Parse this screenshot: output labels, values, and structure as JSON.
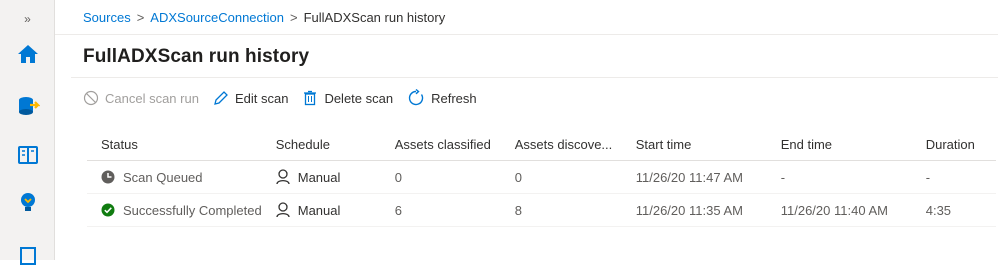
{
  "rail": {
    "expand_label": "»",
    "icons": [
      "home-icon",
      "data-source-icon",
      "catalog-icon",
      "insights-icon",
      "management-icon"
    ]
  },
  "breadcrumb": {
    "sources": "Sources",
    "connection": "ADXSourceConnection",
    "current": "FullADXScan run history",
    "separator": ">"
  },
  "page_title": "FullADXScan run history",
  "toolbar": {
    "cancel_label": "Cancel scan run",
    "edit_label": "Edit scan",
    "delete_label": "Delete scan",
    "refresh_label": "Refresh"
  },
  "table": {
    "columns": [
      "Status",
      "Schedule",
      "Assets classified",
      "Assets discove...",
      "Start time",
      "End time",
      "Duration"
    ],
    "rows": [
      {
        "status": "Scan Queued",
        "status_icon": "clock-icon",
        "schedule": "Manual",
        "assets_classified": "0",
        "assets_discovered": "0",
        "start_time": "11/26/20 11:47 AM",
        "end_time": "-",
        "duration": "-"
      },
      {
        "status": "Successfully Completed",
        "status_icon": "check-circle-icon",
        "schedule": "Manual",
        "assets_classified": "6",
        "assets_discovered": "8",
        "start_time": "11/26/20 11:35 AM",
        "end_time": "11/26/20 11:40 AM",
        "duration": "4:35"
      }
    ]
  },
  "colors": {
    "link": "#0078d4",
    "success": "#107c10",
    "queued": "#605e5c",
    "rail_background": "#f3f2f1"
  }
}
